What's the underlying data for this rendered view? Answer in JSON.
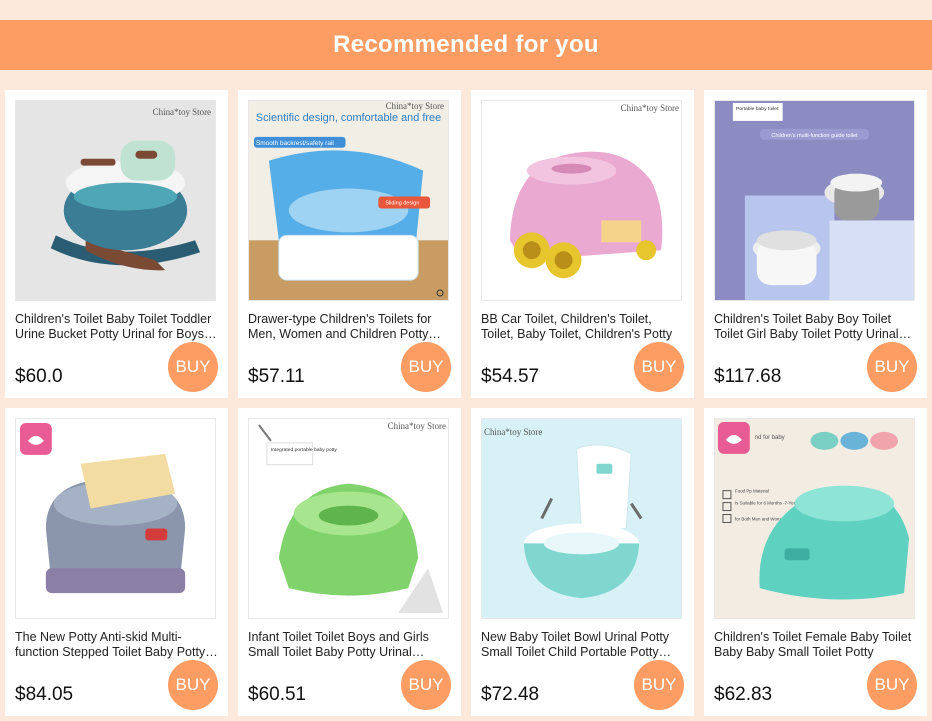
{
  "header": {
    "title": "Recommended for you"
  },
  "products": [
    {
      "title": "Children's Toilet Baby Toilet Toddler Urine Bucket Potty Urinal for Boys and Girls",
      "price": "$60.0",
      "buy_label": "BUY",
      "image_text": "China*toy Store"
    },
    {
      "title": "Drawer-type Children's Toilets for Men, Women and Children Potty Seat",
      "price": "$57.11",
      "buy_label": "BUY",
      "image_text": "China*toy Store",
      "image_caption": "Scientific design, comfortable and free",
      "image_badge": "Smooth backrest/safety rail",
      "image_badge2": "Sliding design"
    },
    {
      "title": "BB Car Toilet, Children's Toilet, Toilet, Baby Toilet, Children's Potty",
      "price": "$54.57",
      "buy_label": "BUY",
      "image_text": "China*toy Store"
    },
    {
      "title": "Children's Toilet Baby Boy Toilet Toilet Girl Baby Toilet Potty Urinal Seat",
      "price": "$117.68",
      "buy_label": "BUY",
      "image_tag": "Portable baby toilet",
      "image_caption": "Children's multi-function guide toilet"
    },
    {
      "title": "The New Potty Anti-skid Multi-function Stepped Toilet Baby Potty Seat",
      "price": "$84.05",
      "buy_label": "BUY"
    },
    {
      "title": "Infant Toilet Toilet Boys and Girls Small Toilet Baby Potty Urinal Bucket",
      "price": "$60.51",
      "buy_label": "BUY",
      "image_text": "China*toy Store",
      "image_tag": "Integrated portable baby potty"
    },
    {
      "title": "New Baby Toilet Bowl Urinal Potty Small Toilet Child Portable Potty Seat",
      "price": "$72.48",
      "buy_label": "BUY",
      "image_text": "China*toy Store"
    },
    {
      "title": "Children's Toilet Female Baby Toilet Baby Baby Small Toilet Potty",
      "price": "$62.83",
      "buy_label": "BUY",
      "image_caption": "nd for baby",
      "image_lines": [
        "Food Pp Material",
        "Is Suitable for 6 Months -7-Year-Old",
        "for Both Men and Women"
      ]
    }
  ],
  "colors": {
    "accent": "#fd9c63",
    "background": "#fde9db"
  }
}
